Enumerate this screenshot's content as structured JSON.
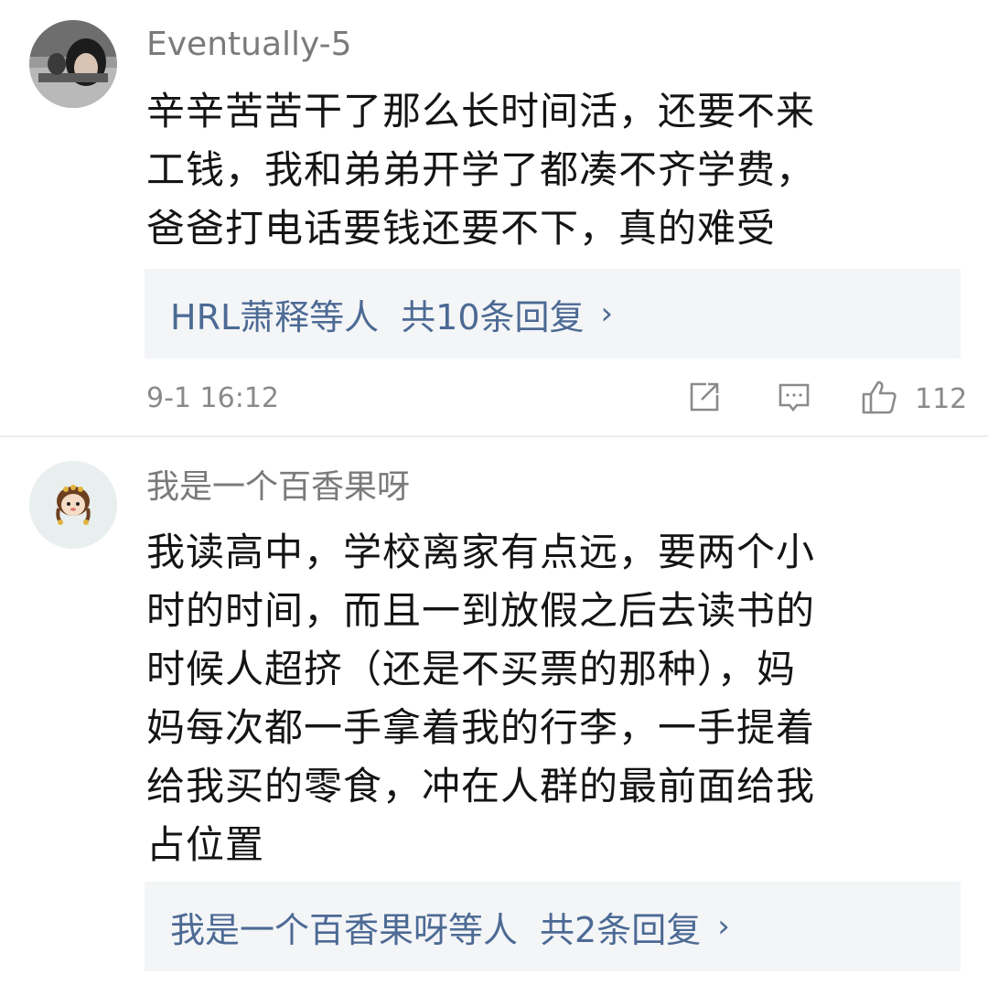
{
  "comments": [
    {
      "username": "Eventually-5",
      "lines": [
        "辛辛苦苦干了那么长时间活，还要不来",
        "工钱，我和弟弟开学了都凑不齐学费，",
        "爸爸打电话要钱还要不下，真的难受"
      ],
      "replies": {
        "users": "HRL萧释等人",
        "count": "共10条回复",
        "chevron": "›"
      },
      "time": "9-1 16:12",
      "actions": {
        "share_icon": "share-icon",
        "reply_icon": "comment-icon",
        "like_icon": "thumbs-up-icon",
        "like_count": "112"
      }
    },
    {
      "username": "我是一个百香果呀",
      "lines": [
        "我读高中，学校离家有点远，要两个小",
        "时的时间，而且一到放假之后去读书的",
        "时候人超挤（还是不买票的那种），妈",
        "妈每次都一手拿着我的行李，一手提着",
        "给我买的零食，冲在人群的最前面给我",
        "占位置"
      ],
      "replies": {
        "users": "我是一个百香果呀等人",
        "count": "共2条回复",
        "chevron": "›"
      }
    }
  ],
  "colors": {
    "link": "#4c6a94",
    "username": "#7a7a7a",
    "reply_box_bg": "#f4f5f7",
    "meta": "#8a8a8a"
  }
}
